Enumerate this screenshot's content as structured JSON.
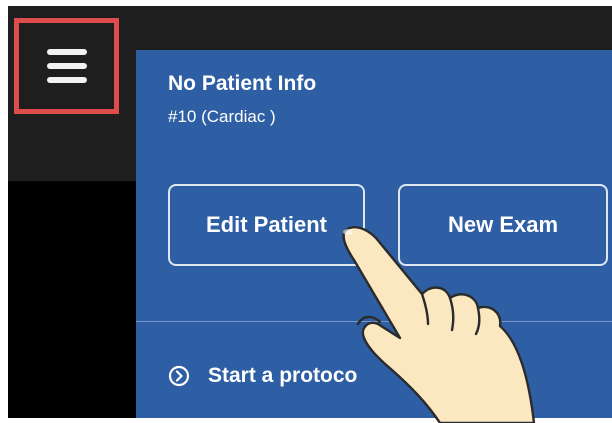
{
  "patient": {
    "name": "No Patient Info",
    "exam_id": "#10 (Cardiac )"
  },
  "buttons": {
    "edit_patient": "Edit Patient",
    "new_exam": "New Exam"
  },
  "protocol": {
    "label": "Start a protoco"
  },
  "icons": {
    "menu": "hamburger-menu-icon",
    "protocol": "chevron-right-circle-icon",
    "pointer": "pointing-hand"
  },
  "colors": {
    "panel": "#2e5ea4",
    "highlight": "#de4c4c",
    "topbar": "#1e1e1e"
  }
}
